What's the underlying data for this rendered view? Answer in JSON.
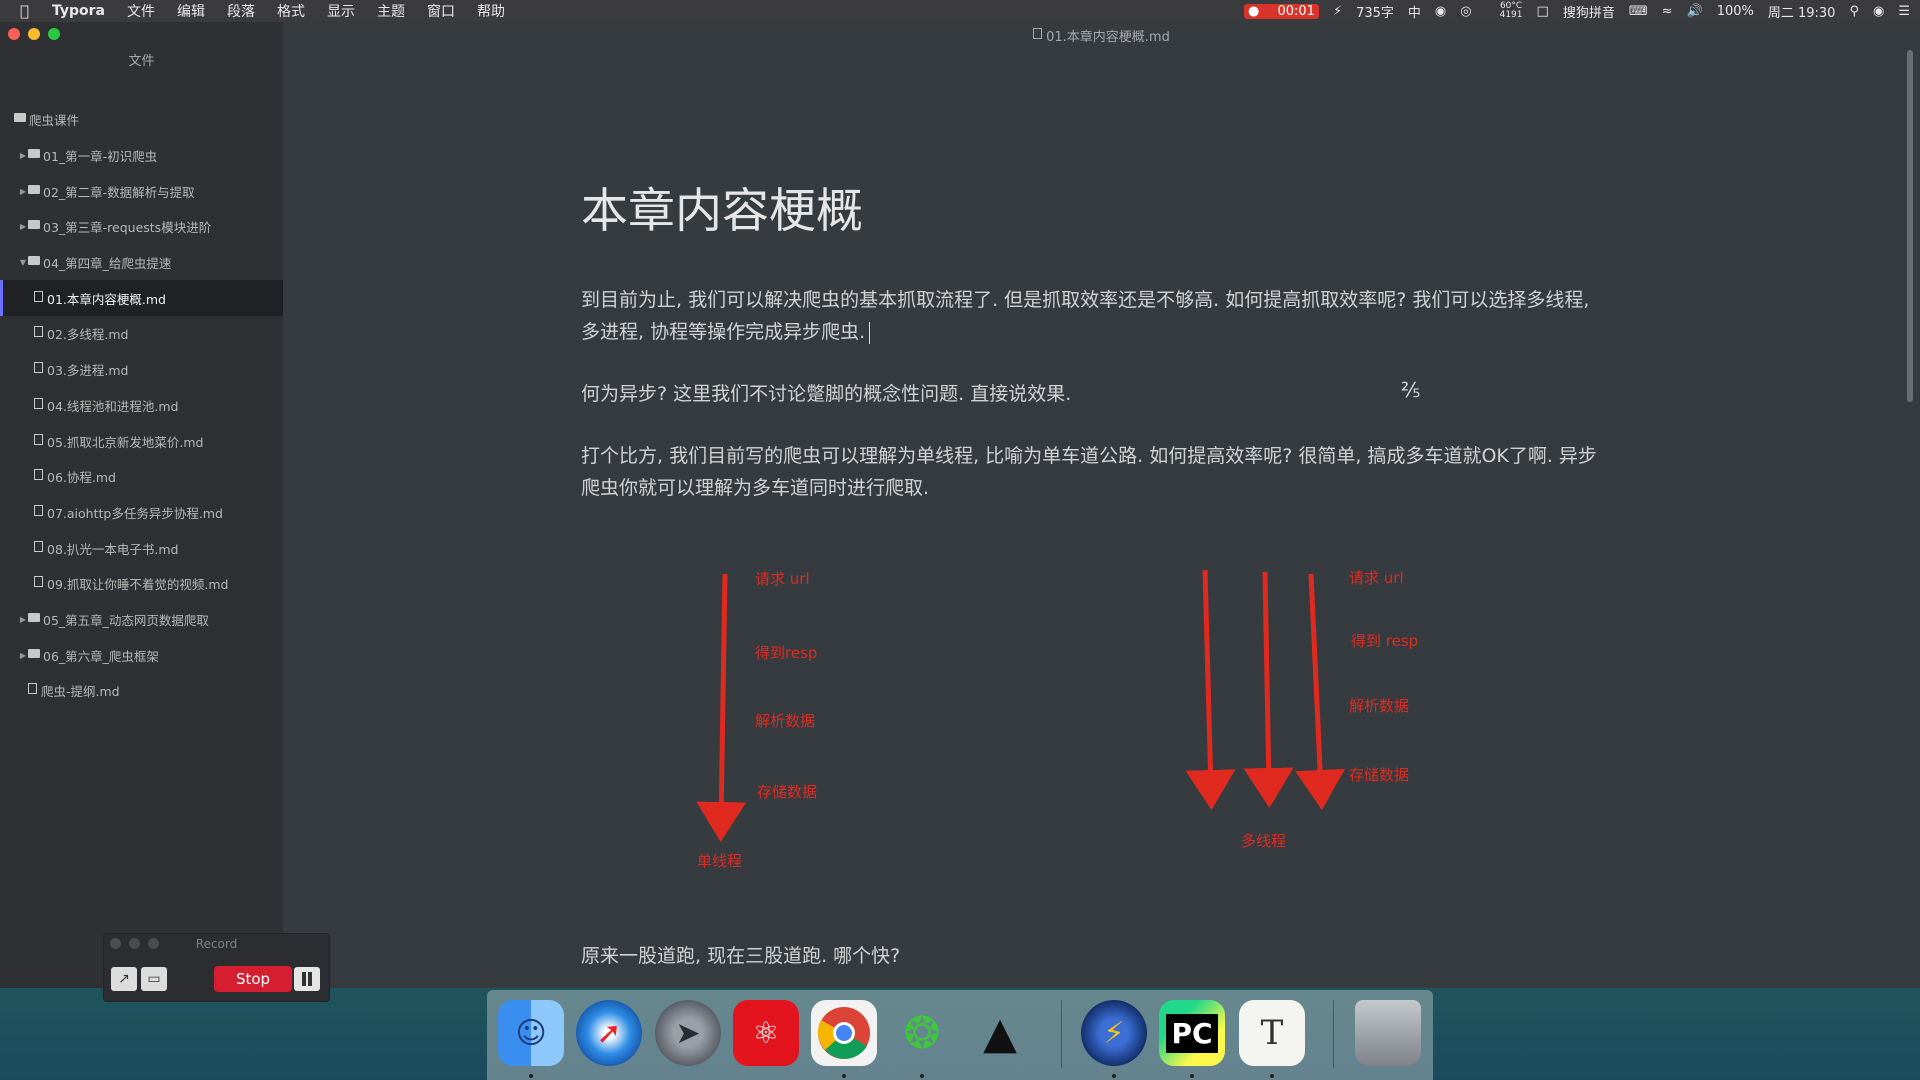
{
  "menubar": {
    "app": "Typora",
    "items": [
      "文件",
      "编辑",
      "段落",
      "格式",
      "显示",
      "主题",
      "窗口",
      "帮助"
    ],
    "record_time": "00:01",
    "word_count": "735字",
    "input_lang": "中",
    "temp": "60°C",
    "temp_sub": "4191",
    "ime": "搜狗拼音",
    "battery": "100%",
    "clock": "周二 19:30"
  },
  "sidebar": {
    "title": "文件",
    "root": "爬虫课件",
    "items": [
      {
        "label": "01_第一章-初识爬虫",
        "type": "folder",
        "level": 1
      },
      {
        "label": "02_第二章-数据解析与提取",
        "type": "folder",
        "level": 1
      },
      {
        "label": "03_第三章-requests模块进阶",
        "type": "folder",
        "level": 1
      },
      {
        "label": "04_第四章_给爬虫提速",
        "type": "folder-open",
        "level": 1
      },
      {
        "label": "01.本章内容梗概.md",
        "type": "file",
        "level": 2,
        "active": true
      },
      {
        "label": "02.多线程.md",
        "type": "file",
        "level": 2
      },
      {
        "label": "03.多进程.md",
        "type": "file",
        "level": 2
      },
      {
        "label": "04.线程池和进程池.md",
        "type": "file",
        "level": 2
      },
      {
        "label": "05.抓取北京新发地菜价.md",
        "type": "file",
        "level": 2
      },
      {
        "label": "06.协程.md",
        "type": "file",
        "level": 2
      },
      {
        "label": "07.aiohttp多任务异步协程.md",
        "type": "file",
        "level": 2
      },
      {
        "label": "08.扒光一本电子书.md",
        "type": "file",
        "level": 2
      },
      {
        "label": "09.抓取让你睡不着觉的视频.md",
        "type": "file",
        "level": 2
      },
      {
        "label": "05_第五章_动态网页数据爬取",
        "type": "folder",
        "level": 1
      },
      {
        "label": "06_第六章_爬虫框架",
        "type": "folder",
        "level": 1
      },
      {
        "label": "爬虫-提纲.md",
        "type": "file",
        "level": 0
      }
    ]
  },
  "editor": {
    "file_name": "01.本章内容梗概.md",
    "heading": "本章内容梗概",
    "p1": "到目前为止, 我们可以解决爬虫的基本抓取流程了. 但是抓取效率还是不够高. 如何提高抓取效率呢? 我们可以选择多线程, 多进程, 协程等操作完成异步爬虫.",
    "p2": "何为异步? 这里我们不讨论蹩脚的概念性问题. 直接说效果.",
    "p3": "打个比方, 我们目前写的爬虫可以理解为单线程, 比喻为单车道公路. 如何提高效率呢? 很简单, 搞成多车道就OK了啊. 异步爬虫你就可以理解为多车道同时进行爬取.",
    "p4": "原来一股道跑, 现在三股道跑. 哪个快?"
  },
  "diagram": {
    "single": {
      "steps": [
        "请求 url",
        "得到resp",
        "解析数据",
        "存储数据"
      ],
      "caption": "单线程"
    },
    "multi": {
      "steps": [
        "请求 url",
        "得到 resp",
        "解析数据",
        "存储数据"
      ],
      "caption": "多线程"
    },
    "color": "#e12a1f"
  },
  "record": {
    "title": "Record",
    "stop_label": "Stop"
  },
  "dock": {
    "apps": [
      "finder-icon",
      "safari-icon",
      "launchpad-icon",
      "netease-music-icon",
      "chrome-icon",
      "wechat-icon",
      "qq-icon",
      "reeder-icon",
      "pycharm-icon",
      "typora-icon",
      "trash-icon"
    ],
    "pycharm_label": "PC",
    "typora_label": "T"
  }
}
